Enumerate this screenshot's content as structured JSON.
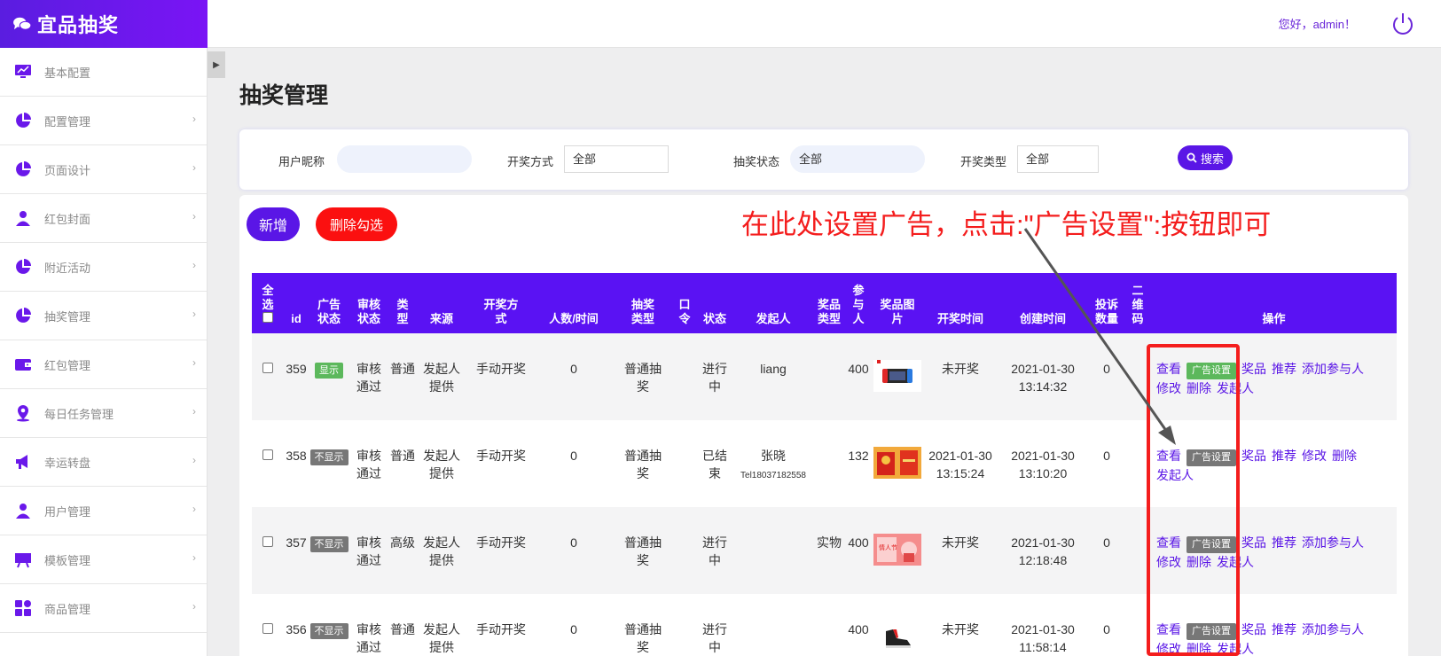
{
  "app": {
    "title": "宜品抽奖",
    "greeting": "您好，admin！"
  },
  "sidebar": {
    "items": [
      {
        "label": "基本配置",
        "icon": "monitor-chart-icon"
      },
      {
        "label": "配置管理",
        "icon": "pie-chart-icon"
      },
      {
        "label": "页面设计",
        "icon": "pie-chart-icon"
      },
      {
        "label": "红包封面",
        "icon": "user-icon"
      },
      {
        "label": "附近活动",
        "icon": "pie-chart-icon"
      },
      {
        "label": "抽奖管理",
        "icon": "pie-chart-icon"
      },
      {
        "label": "红包管理",
        "icon": "wallet-icon"
      },
      {
        "label": "每日任务管理",
        "icon": "location-user-icon"
      },
      {
        "label": "幸运转盘",
        "icon": "megaphone-icon"
      },
      {
        "label": "用户管理",
        "icon": "user-icon"
      },
      {
        "label": "模板管理",
        "icon": "board-icon"
      },
      {
        "label": "商品管理",
        "icon": "apps-icon"
      }
    ]
  },
  "page": {
    "title": "抽奖管理"
  },
  "search": {
    "nickname_label": "用户昵称",
    "nickname_value": "",
    "draw_method_label": "开奖方式",
    "draw_method_value": "全部",
    "status_label": "抽奖状态",
    "status_value": "全部",
    "draw_type_label": "开奖类型",
    "draw_type_value": "全部",
    "search_button": "搜索"
  },
  "actions": {
    "add_label": "新增",
    "delete_selected_label": "删除勾选"
  },
  "annotation": {
    "text": "在此处设置广告，点击:\"广告设置\":按钮即可"
  },
  "table": {
    "headers": {
      "select_all": "全选",
      "id": "id",
      "ad_status": "广告状态",
      "review_status": "审核状态",
      "type": "类型",
      "source": "来源",
      "draw_method": "开奖方式",
      "people_time": "人数/时间",
      "lottery_type": "抽奖类型",
      "password": "口令",
      "status": "状态",
      "initiator": "发起人",
      "prize_type": "奖品类型",
      "participants": "参与人",
      "prize_image": "奖品图片",
      "draw_time": "开奖时间",
      "created_time": "创建时间",
      "complaints": "投诉数量",
      "qrcode": "二维码",
      "operations": "操作"
    },
    "rows": [
      {
        "id": "359",
        "ad_status": "显示",
        "ad_status_color": "#5cb85c",
        "review": "审核通过",
        "type": "普通",
        "source": "发起人提供",
        "draw_method": "手动开奖",
        "people_time": "0",
        "lottery_type": "普通抽奖",
        "password": "",
        "status": "进行中",
        "initiator": "liang",
        "initiator_tel": "",
        "prize_type": "",
        "participants": "400",
        "prize_icon": "game-console-image",
        "draw_time": "未开奖",
        "created": "2021-01-30 13:14:32",
        "complaints": "0",
        "view": "查看",
        "ad_button": "广告设置",
        "ad_button_color": "#5cb85c",
        "ops": [
          "奖品",
          "推荐",
          "添加参与人",
          "修改",
          "删除",
          "发起人"
        ]
      },
      {
        "id": "358",
        "ad_status": "不显示",
        "ad_status_color": "#777777",
        "review": "审核通过",
        "type": "普通",
        "source": "发起人提供",
        "draw_method": "手动开奖",
        "people_time": "0",
        "lottery_type": "普通抽奖",
        "password": "",
        "status": "已结束",
        "initiator": "张晓",
        "initiator_tel": "Tel18037182558",
        "prize_type": "",
        "participants": "132",
        "prize_icon": "red-envelope-image",
        "draw_time": "2021-01-30 13:15:24",
        "created": "2021-01-30 13:10:20",
        "complaints": "0",
        "view": "查看",
        "ad_button": "广告设置",
        "ad_button_color": "#777777",
        "ops": [
          "奖品",
          "推荐",
          "修改",
          "删除",
          "发起人"
        ]
      },
      {
        "id": "357",
        "ad_status": "不显示",
        "ad_status_color": "#777777",
        "review": "审核通过",
        "type": "高级",
        "source": "发起人提供",
        "draw_method": "手动开奖",
        "people_time": "0",
        "lottery_type": "普通抽奖",
        "password": "",
        "status": "进行中",
        "initiator": "",
        "initiator_tel": "",
        "prize_type": "实物",
        "participants": "400",
        "prize_icon": "pink-card-image",
        "draw_time": "未开奖",
        "created": "2021-01-30 12:18:48",
        "complaints": "0",
        "view": "查看",
        "ad_button": "广告设置",
        "ad_button_color": "#777777",
        "ops": [
          "奖品",
          "推荐",
          "添加参与人",
          "修改",
          "删除",
          "发起人"
        ]
      },
      {
        "id": "356",
        "ad_status": "不显示",
        "ad_status_color": "#777777",
        "review": "审核通过",
        "type": "普通",
        "source": "发起人提供",
        "draw_method": "手动开奖",
        "people_time": "0",
        "lottery_type": "普通抽奖",
        "password": "",
        "status": "进行中",
        "initiator": "",
        "initiator_tel": "",
        "prize_type": "",
        "participants": "400",
        "prize_icon": "sneaker-image",
        "draw_time": "未开奖",
        "created": "2021-01-30 11:58:14",
        "complaints": "0",
        "view": "查看",
        "ad_button": "广告设置",
        "ad_button_color": "#777777",
        "ops": [
          "奖品",
          "推荐",
          "添加参与人",
          "修改",
          "删除",
          "发起人"
        ]
      }
    ]
  },
  "colors": {
    "brand": "#5a16e6",
    "danger": "#fb1010",
    "annotation": "#f41d1d"
  }
}
